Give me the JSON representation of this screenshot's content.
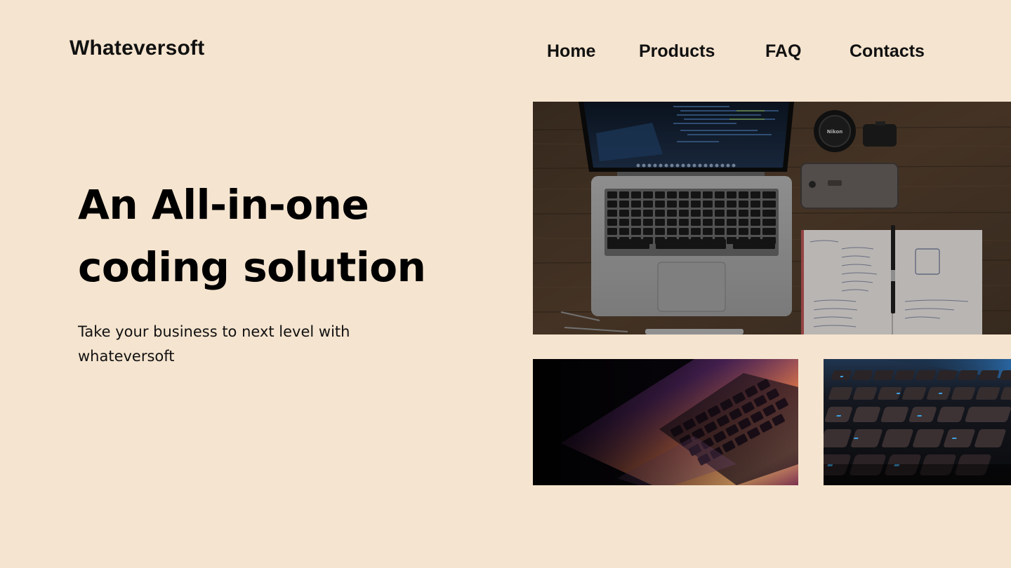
{
  "colors": {
    "background": "#f5e4cf",
    "text": "#111111",
    "heading": "#000000"
  },
  "header": {
    "logo": "Whateversoft",
    "nav": [
      {
        "label": "Home"
      },
      {
        "label": "Products"
      },
      {
        "label": "FAQ"
      },
      {
        "label": "Contacts"
      }
    ]
  },
  "hero": {
    "title_line1": "An All-in-one",
    "title_line2": "coding solution",
    "subtitle_line1": "Take your business to next level with",
    "subtitle_line2": "whateversoft"
  },
  "images": {
    "main": {
      "label": "Laptop with code, camera, phone and notebook on wooden desk",
      "camera_brand": "Nikon"
    },
    "small_left": {
      "label": "Laptop keyboard under colorful light"
    },
    "small_right": {
      "label": "Backlit keyboard close-up"
    }
  }
}
